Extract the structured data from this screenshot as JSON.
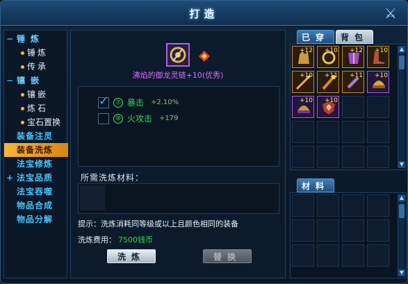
{
  "window": {
    "title": "打造",
    "close_icon": "close-swords-icon"
  },
  "sidebar": {
    "groups": [
      {
        "label": "锤炼",
        "toggle": "−",
        "children": [
          "锤炼",
          "传承"
        ]
      },
      {
        "label": "镶嵌",
        "toggle": "−",
        "children": [
          "镶嵌",
          "炼石",
          "宝石置换"
        ]
      }
    ],
    "main_items": [
      {
        "label": "装备注灵",
        "active": false
      },
      {
        "label": "装备洗炼",
        "active": true
      },
      {
        "label": "法宝修炼",
        "active": false
      },
      {
        "label": "法宝品质",
        "active": false,
        "toggle": "+"
      },
      {
        "label": "法宝吞噬",
        "active": false
      },
      {
        "label": "物品合成",
        "active": false
      },
      {
        "label": "物品分解",
        "active": false
      }
    ]
  },
  "refine": {
    "item_name": "沸焰的御龙灵链+10(优秀)",
    "attributes": [
      {
        "checked": true,
        "num": "⑦",
        "name": "暴击",
        "value": "+2.10%"
      },
      {
        "checked": false,
        "num": "⑩",
        "name": "火攻击",
        "value": "+179"
      }
    ],
    "materials_label": "所需洗炼材料：",
    "hint": "提示：洗炼消耗同等级或以上且颜色相同的装备",
    "fee_label": "洗炼费用：",
    "fee_value": "7500钱币",
    "refine_button": "洗炼",
    "replace_button": "替换"
  },
  "inventory": {
    "tabs": [
      "已穿",
      "背包"
    ],
    "slots": [
      "+12",
      "+10",
      "+12",
      "+10",
      "+10",
      "+11",
      "+11",
      "+10",
      "+10",
      "+10"
    ],
    "materials_tab": "材料"
  },
  "colors": {
    "accent": "#f8b63b",
    "green": "#3ccf55",
    "purple": "#d86bff"
  }
}
